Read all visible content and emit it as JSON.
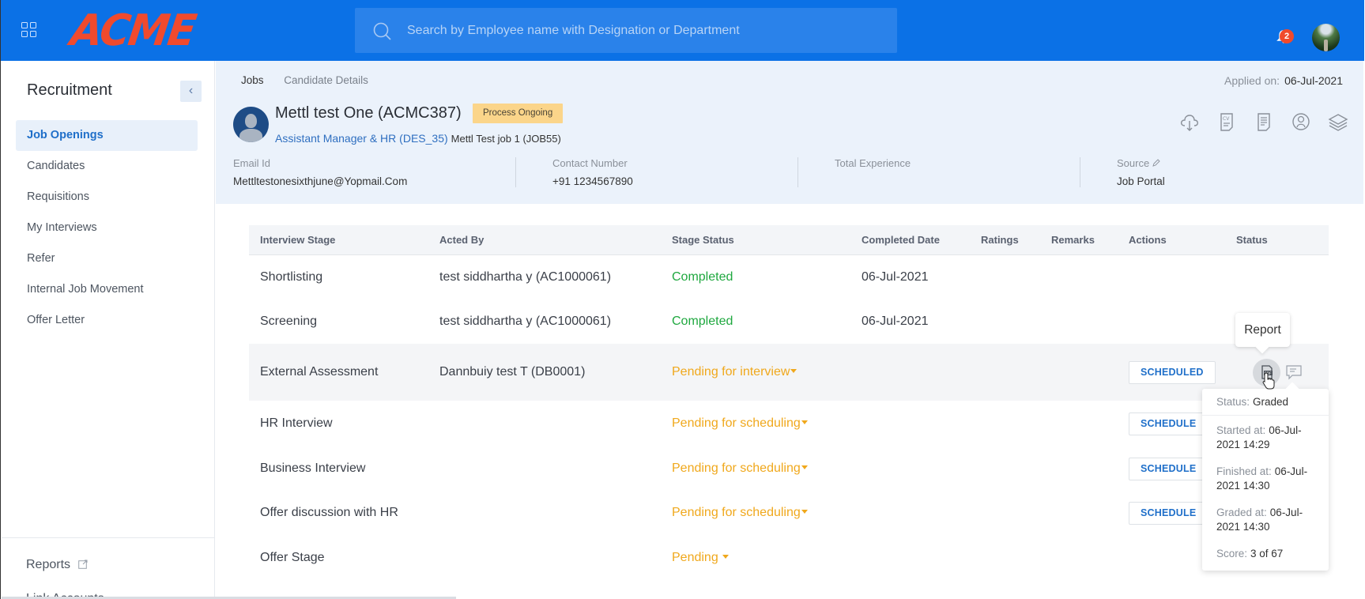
{
  "topbar": {
    "logo": "ACME",
    "search_placeholder": "Search by Employee name with Designation or Department",
    "notification_count": "2",
    "icons": {
      "apps": "grid-icon",
      "search": "search-icon",
      "notifications": "bell-icon",
      "profile": "avatar"
    }
  },
  "sidebar": {
    "title": "Recruitment",
    "collapse_icon": "chevron-left-icon",
    "items": [
      {
        "label": "Job Openings",
        "active": true
      },
      {
        "label": "Candidates"
      },
      {
        "label": "Requisitions"
      },
      {
        "label": "My Interviews"
      },
      {
        "label": "Refer"
      },
      {
        "label": "Internal Job Movement"
      },
      {
        "label": "Offer Letter"
      }
    ],
    "reports_label": "Reports",
    "link_accounts_label": "Link Accounts"
  },
  "header": {
    "breadcrumb": [
      "Jobs",
      "Candidate Details"
    ],
    "applied_label": "Applied on:",
    "applied_date": "06-Jul-2021",
    "candidate_name": "Mettl test One (ACMC387)",
    "process_status": "Process Ongoing",
    "designation": "Assistant Manager & HR (DES_35)",
    "job": "Mettl Test job 1 (JOB55)",
    "action_icons": [
      "cloud-download-icon",
      "cv-document-icon",
      "document-icon",
      "profile-icon",
      "layers-icon"
    ],
    "info": [
      {
        "label": "Email Id",
        "value": "Mettltestonesixthjune@Yopmail.Com"
      },
      {
        "label": "Contact Number",
        "value": "+91 1234567890"
      },
      {
        "label": "Total Experience",
        "value": ""
      },
      {
        "label": "Source",
        "value": "Job Portal"
      }
    ]
  },
  "table": {
    "columns": [
      "Interview Stage",
      "Acted By",
      "Stage Status",
      "Completed Date",
      "Ratings",
      "Remarks",
      "Actions",
      "Status"
    ],
    "rows": [
      {
        "stage": "Shortlisting",
        "acted_by": "test siddhartha y (AC1000061)",
        "status": "Completed",
        "date": "06-Jul-2021",
        "action": ""
      },
      {
        "stage": "Screening",
        "acted_by": "test siddhartha y (AC1000061)",
        "status": "Completed",
        "date": "06-Jul-2021",
        "action": ""
      },
      {
        "stage": "External Assessment",
        "acted_by": "Dannbuiy test T (DB0001)",
        "status": "Pending for interview",
        "date": "",
        "action": "SCHEDULED"
      },
      {
        "stage": "HR Interview",
        "acted_by": "",
        "status": "Pending for scheduling",
        "date": "",
        "action": "SCHEDULE"
      },
      {
        "stage": "Business Interview",
        "acted_by": "",
        "status": "Pending for scheduling",
        "date": "",
        "action": "SCHEDULE"
      },
      {
        "stage": "Offer discussion with HR",
        "acted_by": "",
        "status": "Pending for scheduling",
        "date": "",
        "action": "SCHEDULE"
      },
      {
        "stage": "Offer Stage",
        "acted_by": "",
        "status": "Pending",
        "date": "",
        "action": ""
      }
    ]
  },
  "tooltip": {
    "text": "Report"
  },
  "popover": {
    "status_label": "Status:",
    "status_value": "Graded",
    "started_label": "Started at:",
    "started_value": "06-Jul-2021 14:29",
    "finished_label": "Finished at:",
    "finished_value": "06-Jul-2021 14:30",
    "graded_label": "Graded at:",
    "graded_value": "06-Jul-2021 14:30",
    "score_label": "Score:",
    "score_value": "3 of 67"
  },
  "colors": {
    "brand_blue": "#0b71e6",
    "logo_red": "#f04a2d",
    "completed_green": "#1fa83f",
    "pending_amber": "#f0a81c",
    "badge_yellow": "#fbd58a"
  }
}
